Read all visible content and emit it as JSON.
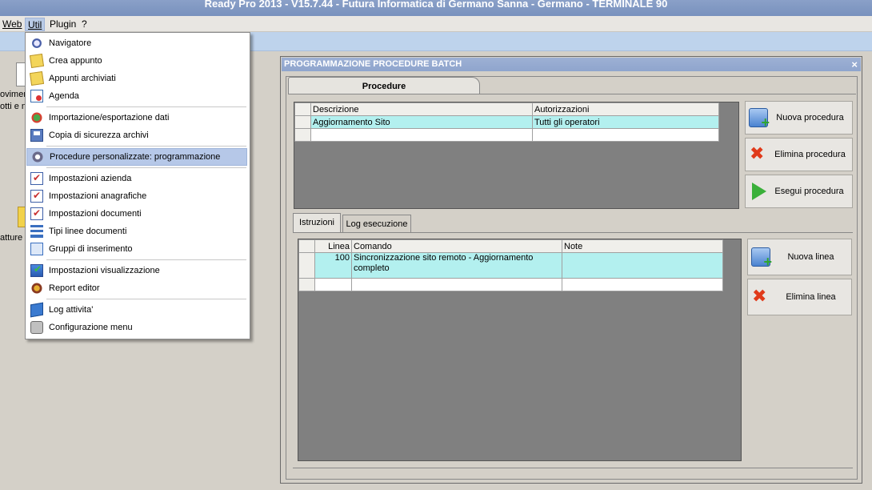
{
  "app": {
    "title": "Ready Pro 2013 - V15.7.44 - Futura Informatica di Germano Sanna - Germano - TERMINALE 90"
  },
  "menubar": {
    "web": "Web",
    "util": "Util",
    "plugin": "Plugin",
    "help": "?"
  },
  "background_partial": {
    "text1": "ovimen",
    "text2": "otti e n",
    "text3": "atture"
  },
  "util_menu": {
    "items": [
      {
        "label": "Navigatore",
        "icon": "navigator-icon"
      },
      {
        "label": "Crea appunto",
        "icon": "note-icon"
      },
      {
        "label": "Appunti archiviati",
        "icon": "notes-archive-icon"
      },
      {
        "label": "Agenda",
        "icon": "agenda-icon"
      },
      {
        "label": "Importazione/esportazione dati",
        "icon": "import-export-icon"
      },
      {
        "label": "Copia di sicurezza archivi",
        "icon": "backup-icon"
      },
      {
        "label": "Procedure personalizzate: programmazione",
        "icon": "gears-icon"
      },
      {
        "label": "Impostazioni azienda",
        "icon": "settings-check-icon"
      },
      {
        "label": "Impostazioni anagrafiche",
        "icon": "settings-check-icon"
      },
      {
        "label": "Impostazioni documenti",
        "icon": "settings-check-icon"
      },
      {
        "label": "Tipi linee documenti",
        "icon": "lines-icon"
      },
      {
        "label": "Gruppi di inserimento",
        "icon": "grid-icon"
      },
      {
        "label": "Impostazioni visualizzazione",
        "icon": "display-icon"
      },
      {
        "label": "Report editor",
        "icon": "report-icon"
      },
      {
        "label": "Log attivita'",
        "icon": "log-icon"
      },
      {
        "label": "Configurazione menu",
        "icon": "config-icon"
      }
    ]
  },
  "window": {
    "title": "PROGRAMMAZIONE PROCEDURE BATCH",
    "close": "×",
    "tab_procedure": "Procedure",
    "procedures_grid": {
      "columns": [
        "Descrizione",
        "Autorizzazioni"
      ],
      "rows": [
        [
          "Aggiornamento Sito",
          "Tutti gli operatori"
        ]
      ]
    },
    "buttons": {
      "new_procedure": "Nuova procedura",
      "delete_procedure": "Elimina procedura",
      "run_procedure": "Esegui procedura",
      "new_line": "Nuova linea",
      "delete_line": "Elimina linea"
    },
    "subtabs": {
      "instructions": "Istruzioni",
      "execution_log": "Log esecuzione"
    },
    "instructions_grid": {
      "columns": [
        "Linea",
        "Comando",
        "Note"
      ],
      "rows": [
        [
          "100",
          "Sincronizzazione sito remoto - Aggiornamento completo",
          ""
        ]
      ]
    }
  }
}
